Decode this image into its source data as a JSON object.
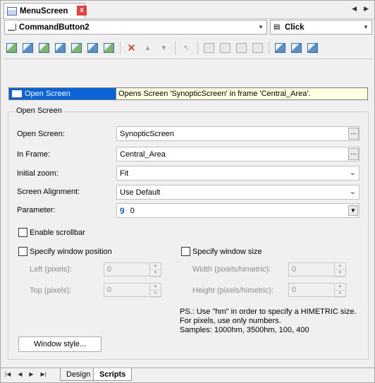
{
  "window": {
    "tab_title": "MenuScreen",
    "close_label": "x",
    "nav_prev": "◀",
    "nav_next": "▶"
  },
  "selectors": {
    "object_value": "CommandButton2",
    "event_value": "Click"
  },
  "toolbar": {
    "icons": [
      "new-command-icon",
      "insert-command-icon",
      "image-command-icon",
      "screen-command-icon",
      "variable-command-icon",
      "settings-command-icon",
      "print-command-icon",
      "delete-icon",
      "move-up-icon",
      "move-down-icon",
      "cursor-icon",
      "find-icon",
      "find-next-icon",
      "replace-icon",
      "check-syntax-icon",
      "list-icon",
      "list-check-icon",
      "list-all-icon"
    ]
  },
  "command_list": {
    "rows": [
      {
        "command": "Open Screen",
        "description": "Opens Screen 'SynopticScreen' in frame 'Central_Area'."
      }
    ]
  },
  "group": {
    "title": "Open Screen",
    "open_screen_label": "Open Screen:",
    "open_screen_value": "SynopticScreen",
    "in_frame_label": "In Frame:",
    "in_frame_value": "Central_Area",
    "browse_label": "...",
    "initial_zoom_label": "Initial zoom:",
    "initial_zoom_value": "Fit",
    "alignment_label": "Screen Alignment:",
    "alignment_value": "Use Default",
    "parameter_label": "Parameter:",
    "parameter_value": "0",
    "enable_scrollbar_label": "Enable scrollbar",
    "enable_scrollbar_checked": false,
    "specify_position_label": "Specify window position",
    "specify_position_checked": false,
    "left_label": "Left (pixels):",
    "left_value": "0",
    "top_label": "Top (pixels):",
    "top_value": "0",
    "specify_size_label": "Specify window size",
    "specify_size_checked": false,
    "width_label": "Width (pixels/himetric):",
    "width_value": "0",
    "height_label": "Height (pixels/himetric):",
    "height_value": "0",
    "note_line1": "PS.: Use \"hm\" in order to specify a HIMETRIC size.",
    "note_line2": "For pixels, use only numbers.",
    "note_line3": "Samples: 1000hm, 3500hm, 100, 400",
    "window_style_button": "Window style..."
  },
  "bottom_tabs": {
    "tabs": [
      "Design",
      "Scripts"
    ],
    "active": "Scripts"
  },
  "colors": {
    "selection": "#0a64d8",
    "list_background": "#ffffe1",
    "close_button": "#e04343"
  }
}
